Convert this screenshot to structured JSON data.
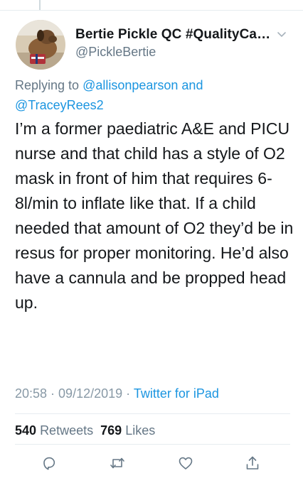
{
  "tweet": {
    "display_name": "Bertie Pickle QC #QualityCan...",
    "handle": "@PickleBertie",
    "replying_to_prefix": "Replying to ",
    "replying_to_user1": "@allisonpearson",
    "replying_to_joiner": " and",
    "replying_to_user2": "@TraceyRees2",
    "body": "I’m a former paediatric A&E and PICU nurse and that child has a style of O2 mask in front of him that requires 6-8l/min to inflate like that. If a child needed that amount of O2 they’d be in resus for proper monitoring. He’d also have a cannula and be propped head up.",
    "time": "20:58",
    "date": "09/12/2019",
    "separator": " · ",
    "source": "Twitter for iPad"
  },
  "stats": {
    "retweets_count": "540",
    "retweets_label": "Retweets",
    "likes_count": "769",
    "likes_label": "Likes"
  },
  "icons": {
    "reply": "reply-icon",
    "retweet": "retweet-icon",
    "like": "heart-icon",
    "share": "share-icon",
    "more": "chevron-down-icon"
  },
  "colors": {
    "link": "#1b95e0",
    "secondary_text": "#657786",
    "meta_text": "#8899a6",
    "primary_text": "#14171a",
    "divider": "#e6ecf0"
  }
}
